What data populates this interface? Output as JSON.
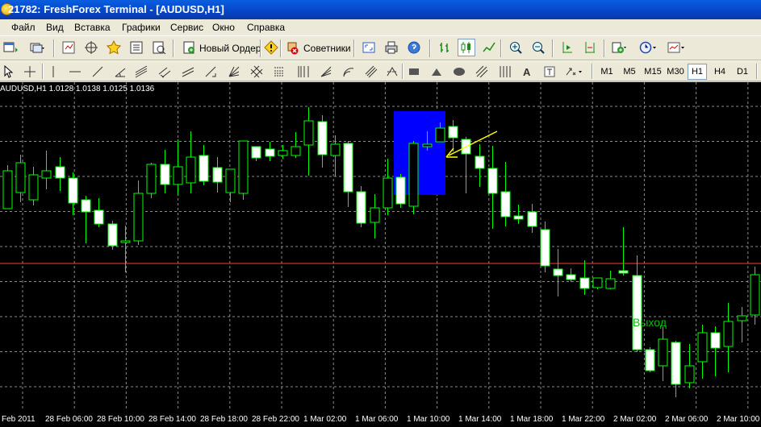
{
  "window": {
    "title": "21782: FreshForex Terminal - [AUDUSD,H1]"
  },
  "menu": [
    "Файл",
    "Вид",
    "Вставка",
    "Графики",
    "Сервис",
    "Окно",
    "Справка"
  ],
  "toolbar": {
    "new_order_label": "Новый Ордер",
    "advisors_label": "Советники"
  },
  "timeframes": [
    "M1",
    "M5",
    "M15",
    "M30",
    "H1",
    "H4",
    "D1"
  ],
  "active_timeframe": "H1",
  "chart": {
    "info_line": "AUDUSD,H1  1.0128 1.0138 1.0125 1.0136",
    "annotation_text": "Выход",
    "background_color": "#000000",
    "candle_color": "#00ff00",
    "bull_fill": "#000000",
    "bear_fill": "#ffffff",
    "grid_color": "#8a8a8a",
    "highlight_color": "#0000ff",
    "arrow_color": "#ffff00",
    "level_line_color": "#ff3b3b"
  },
  "chart_data": {
    "type": "candlestick",
    "symbol": "AUDUSD",
    "timeframe": "H1",
    "last_ohlc": [
      1.0128,
      1.0138,
      1.0125,
      1.0136
    ],
    "x_tick_labels": [
      "Feb 2011",
      "28 Feb 06:00",
      "28 Feb 10:00",
      "28 Feb 14:00",
      "28 Feb 18:00",
      "28 Feb 22:00",
      "1 Mar 02:00",
      "1 Mar 06:00",
      "1 Mar 10:00",
      "1 Mar 14:00",
      "1 Mar 18:00",
      "1 Mar 22:00",
      "2 Mar 02:00",
      "2 Mar 06:00",
      "2 Mar 10:00"
    ],
    "candles": [
      [
        259.0,
        212.0,
        220.0,
        205.0
      ],
      [
        239.0,
        202.0,
        251.0,
        192.0
      ],
      [
        248.0,
        217.0,
        255.0,
        207.0
      ],
      [
        221.0,
        212.0,
        235.0,
        187.0
      ],
      [
        207.0,
        221.0,
        195.0,
        237.0
      ],
      [
        221.0,
        252.0,
        214.0,
        267.0
      ],
      [
        248.0,
        263.0,
        243.0,
        302.0
      ],
      [
        261.0,
        278.0,
        246.0,
        282.0
      ],
      [
        278.0,
        305.0,
        274.0,
        310.0
      ],
      [
        301.0,
        299.0,
        280.0,
        338.0
      ],
      [
        299.0,
        240.0,
        224.0,
        304.0
      ],
      [
        240.0,
        204.0,
        202.0,
        246.0
      ],
      [
        204.0,
        229.0,
        186.0,
        240.0
      ],
      [
        229.0,
        207.0,
        173.0,
        242.0
      ],
      [
        227.0,
        195.0,
        163.0,
        240.0
      ],
      [
        193.0,
        225.0,
        180.0,
        230.0
      ],
      [
        208.0,
        226.0,
        195.0,
        239.0
      ],
      [
        239.0,
        210.0,
        216.0,
        251.0
      ],
      [
        240.0,
        175.0,
        191.0,
        248.0
      ],
      [
        182.0,
        196.0,
        185.0,
        200.0
      ],
      [
        185.0,
        194.0,
        176.0,
        200.0
      ],
      [
        193.0,
        187.0,
        180.0,
        197.0
      ],
      [
        193.0,
        182.0,
        164.0,
        196.0
      ],
      [
        180.0,
        150.0,
        133.0,
        218.0
      ],
      [
        151.0,
        192.0,
        143.0,
        208.0
      ],
      [
        193.0,
        179.0,
        168.0,
        219.0
      ],
      [
        178.0,
        238.0,
        175.0,
        257.0
      ],
      [
        238.0,
        277.0,
        231.0,
        282.0
      ],
      [
        276.0,
        258.0,
        241.0,
        296.0
      ],
      [
        258.0,
        221.0,
        197.0,
        267.0
      ],
      [
        220.0,
        253.0,
        216.0,
        258.0
      ],
      [
        256.0,
        178.0,
        175.0,
        266.0
      ],
      [
        182.0,
        179.0,
        163.0,
        187.0
      ],
      [
        176.0,
        159.0,
        152.0,
        174.0
      ],
      [
        157.0,
        171.0,
        149.0,
        188.0
      ],
      [
        173.0,
        191.0,
        170.0,
        240.0
      ],
      [
        194.0,
        209.0,
        179.0,
        232.0
      ],
      [
        209.0,
        240.0,
        181.0,
        284.0
      ],
      [
        238.0,
        269.0,
        201.0,
        281.0
      ],
      [
        268.0,
        272.0,
        254.0,
        278.0
      ],
      [
        263.0,
        281.0,
        253.0,
        289.0
      ],
      [
        285.0,
        330.0,
        275.0,
        338.0
      ],
      [
        334.0,
        342.0,
        309.0,
        368.0
      ],
      [
        341.0,
        347.0,
        333.0,
        350.0
      ],
      [
        345.0,
        358.0,
        323.0,
        366.0
      ],
      [
        357.0,
        345.0,
        347.0,
        359.0
      ],
      [
        358.0,
        346.0,
        336.0,
        359.0
      ],
      [
        336.0,
        339.0,
        282.0,
        342.0
      ],
      [
        342.0,
        434.0,
        317.0,
        437.0
      ],
      [
        434.0,
        460.0,
        431.0,
        462.0
      ],
      [
        454.0,
        421.0,
        406.0,
        473.0
      ],
      [
        425.0,
        477.0,
        423.0,
        493.0
      ],
      [
        475.0,
        454.0,
        427.0,
        482.0
      ],
      [
        449.0,
        413.0,
        403.0,
        470.0
      ],
      [
        413.0,
        432.0,
        405.0,
        467.0
      ],
      [
        430.0,
        399.0,
        376.0,
        462.0
      ],
      [
        398.0,
        392.0,
        381.0,
        425.0
      ],
      [
        391.0,
        341.0,
        331.0,
        403.0
      ],
      [
        339.0,
        334.0,
        319.0,
        349.0
      ],
      [
        334.0,
        311.0,
        301.0,
        377.0
      ],
      [
        313.0,
        333.0,
        304.0,
        338.0
      ],
      [
        340.0,
        314.0,
        303.0,
        346.0
      ]
    ]
  }
}
